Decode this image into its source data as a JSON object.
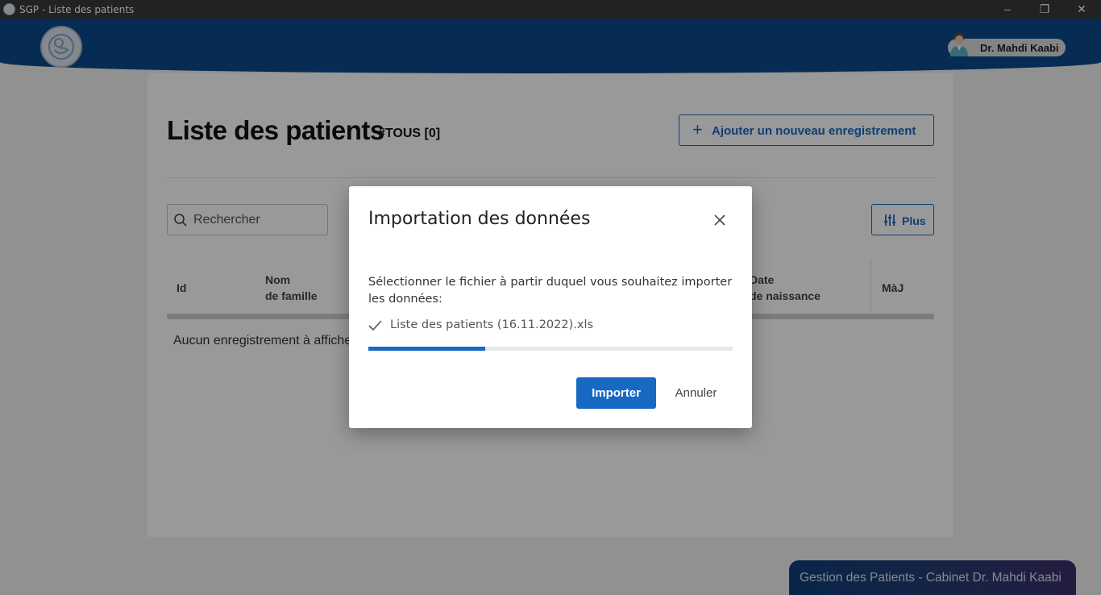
{
  "window": {
    "title": "SGP - Liste des patients",
    "controls": {
      "minimize": "–",
      "maximize": "❐",
      "close": "✕"
    }
  },
  "header": {
    "logo_icon": "baby-logo-icon",
    "user": {
      "name": "Dr. Mahdi Kaabi",
      "avatar_icon": "doctor-avatar-icon"
    }
  },
  "page": {
    "title": "Liste des patients",
    "title_tag": "#TOUS [0]",
    "add_button_label": "Ajouter un nouveau enregistrement",
    "search": {
      "placeholder": "Rechercher",
      "value": ""
    },
    "more_button_label": "Plus",
    "table": {
      "columns": [
        {
          "line1": "Id",
          "line2": ""
        },
        {
          "line1": "Nom",
          "line2": "de famille"
        },
        {
          "line1": "Date",
          "line2": "de naissance"
        },
        {
          "line1": "MàJ",
          "line2": ""
        }
      ],
      "empty_message": "Aucun enregistrement à afficher"
    }
  },
  "dialog": {
    "title": "Importation des données",
    "message": "Sélectionner le fichier à partir duquel vous souhaitez importer les données:",
    "file_name": "Liste des patients (16.11.2022).xls",
    "progress": 0.32,
    "import_label": "Importer",
    "cancel_label": "Annuler"
  },
  "footer": {
    "label": "Gestion des Patients - Cabinet Dr. Mahdi Kaabi"
  },
  "colors": {
    "primary": "#1769c2",
    "header": "#0d4a8a",
    "titlebar": "#3a3a3a"
  }
}
